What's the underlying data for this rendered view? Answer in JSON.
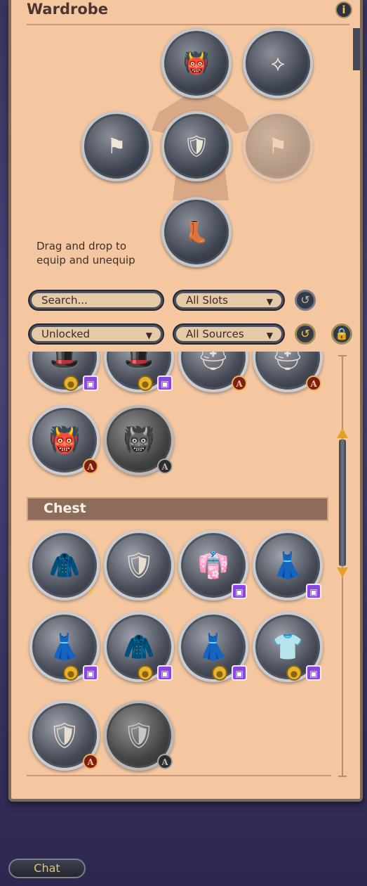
{
  "panel": {
    "title": "Wardrobe",
    "info_icon": "info-icon"
  },
  "equip": {
    "hint_line1": "Drag and drop to",
    "hint_line2": "equip and unequip",
    "slots": [
      {
        "slot": "head",
        "icon": "oni-mask-helmet-icon"
      },
      {
        "slot": "back",
        "icon": "cape-icon"
      },
      {
        "slot": "left-hand",
        "icon": "banner-staff-icon"
      },
      {
        "slot": "chest",
        "icon": "red-armor-chest-icon"
      },
      {
        "slot": "right-hand",
        "icon": "banner-staff-faded-icon"
      },
      {
        "slot": "feet",
        "icon": "red-boots-icon"
      }
    ]
  },
  "filters": {
    "search_placeholder": "Search...",
    "slot_filter": "All Slots",
    "status_filter": "Unlocked",
    "source_filter": "All Sources"
  },
  "sections": [
    {
      "name": "Chest"
    }
  ],
  "colors": {
    "panel": "#f4c7a1",
    "section_header": "#8e6c5a",
    "twitch": "#8b45e0",
    "coin": "#e9b332"
  },
  "chat": {
    "label": "Chat"
  }
}
